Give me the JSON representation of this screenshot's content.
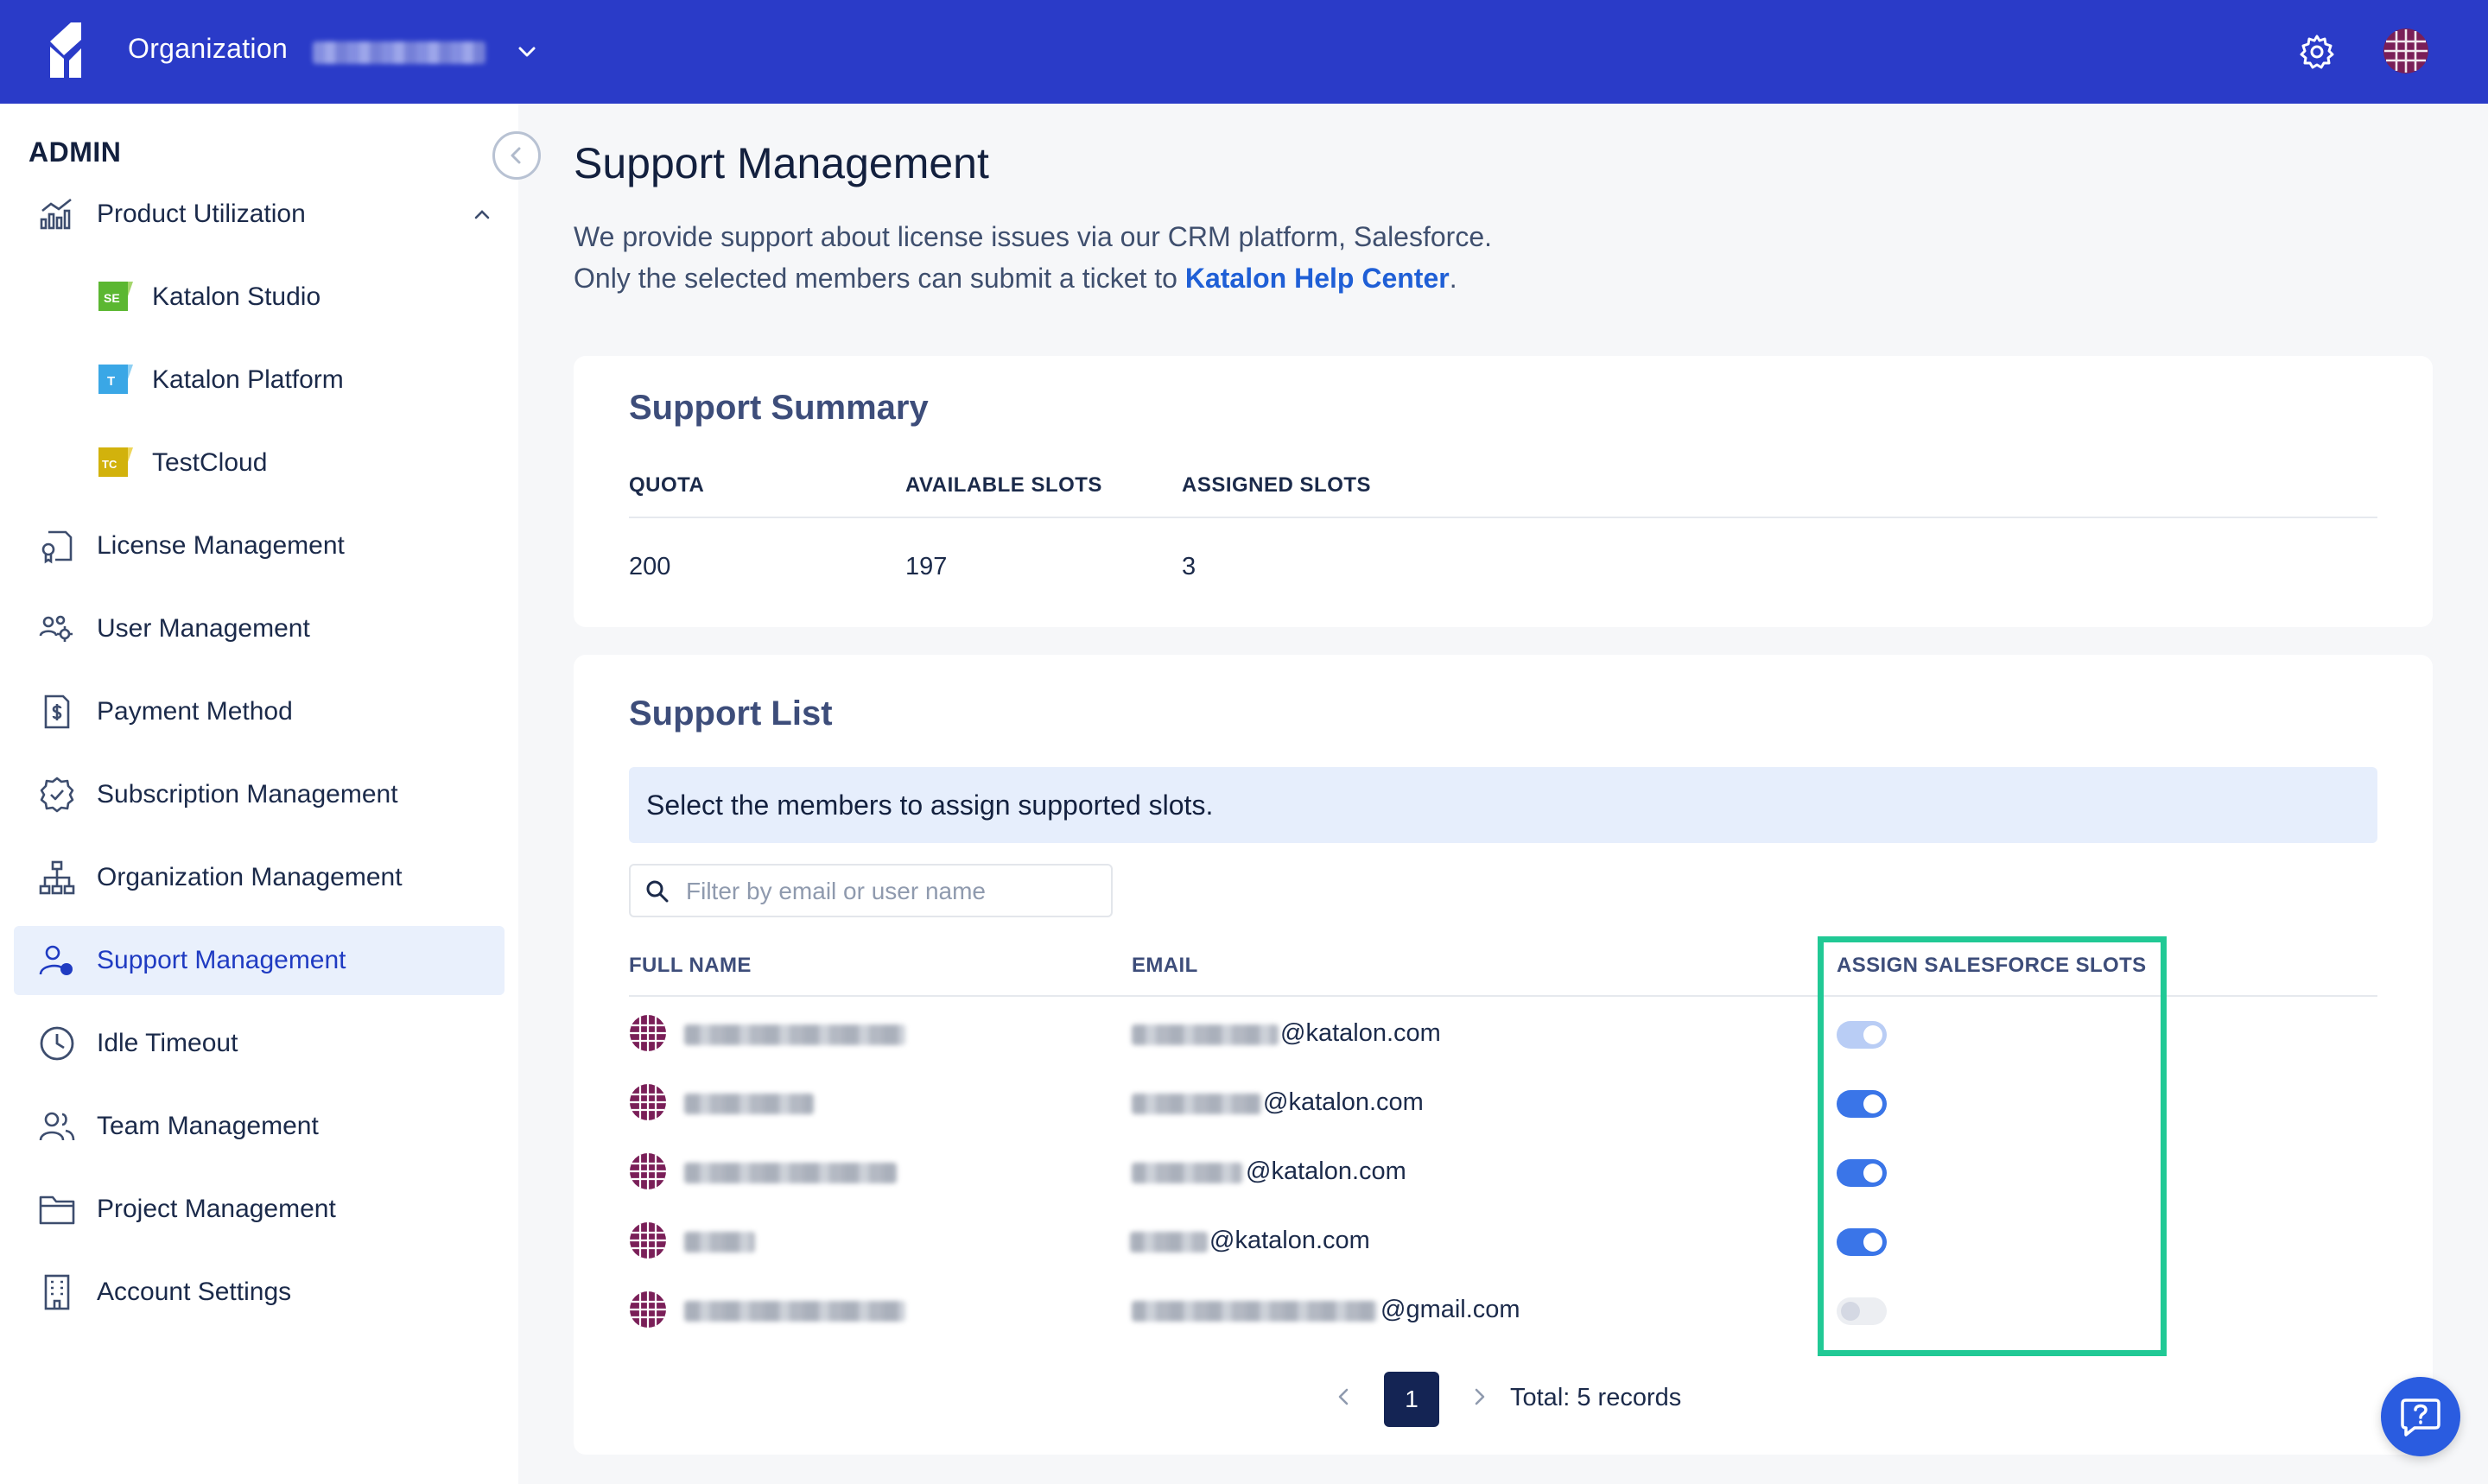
{
  "topbar": {
    "org_label": "Organization",
    "icons": {
      "logo": "katalon-logo-icon",
      "chevron": "chevron-down-icon",
      "settings": "gear-icon",
      "avatar": "user-avatar"
    }
  },
  "sidebar": {
    "title": "ADMIN",
    "items": [
      {
        "label": "Product Utilization",
        "icon": "chart-icon",
        "expanded": true
      },
      {
        "label": "Katalon Studio",
        "icon": "katalon-studio-icon",
        "sub": true
      },
      {
        "label": "Katalon Platform",
        "icon": "katalon-platform-icon",
        "sub": true
      },
      {
        "label": "TestCloud",
        "icon": "testcloud-icon",
        "sub": true
      },
      {
        "label": "License Management",
        "icon": "license-icon"
      },
      {
        "label": "User Management",
        "icon": "users-gear-icon"
      },
      {
        "label": "Payment Method",
        "icon": "payment-icon"
      },
      {
        "label": "Subscription Management",
        "icon": "badge-check-icon"
      },
      {
        "label": "Organization Management",
        "icon": "org-tree-icon"
      },
      {
        "label": "Support Management",
        "icon": "user-support-icon",
        "active": true
      },
      {
        "label": "Idle Timeout",
        "icon": "clock-icon"
      },
      {
        "label": "Team Management",
        "icon": "team-icon"
      },
      {
        "label": "Project Management",
        "icon": "folder-icon"
      },
      {
        "label": "Account Settings",
        "icon": "building-icon"
      }
    ]
  },
  "main": {
    "title": "Support Management",
    "intro_line1": "We provide support about license issues via our CRM platform, Salesforce.",
    "intro_line2_prefix": "Only the selected members can submit a ticket to ",
    "intro_link": "Katalon Help Center",
    "intro_line2_suffix": "."
  },
  "summary": {
    "title": "Support Summary",
    "headers": [
      "QUOTA",
      "AVAILABLE SLOTS",
      "ASSIGNED SLOTS"
    ],
    "values": [
      "200",
      "197",
      "3"
    ]
  },
  "support_list": {
    "title": "Support List",
    "banner": "Select the members to assign supported slots.",
    "filter_placeholder": "Filter by email or user name",
    "columns": [
      "FULL NAME",
      "EMAIL",
      "ASSIGN SALESFORCE SLOTS"
    ],
    "rows": [
      {
        "email_domain": "@katalon.com",
        "assigned": true,
        "disabled": true
      },
      {
        "email_domain": "@katalon.com",
        "assigned": true,
        "disabled": false
      },
      {
        "email_domain": "@katalon.com",
        "assigned": true,
        "disabled": false
      },
      {
        "email_domain": "@katalon.com",
        "assigned": true,
        "disabled": false
      },
      {
        "email_domain": "@gmail.com",
        "assigned": false,
        "disabled": true
      }
    ],
    "pagination": {
      "current_page": "1",
      "total": "Total: 5 records"
    }
  },
  "colors": {
    "topbar": "#2a3bc8",
    "accent": "#3a75e8",
    "highlight": "#21c995",
    "active_nav_bg": "#e9f0fc",
    "avatar": "#7a1f58"
  }
}
